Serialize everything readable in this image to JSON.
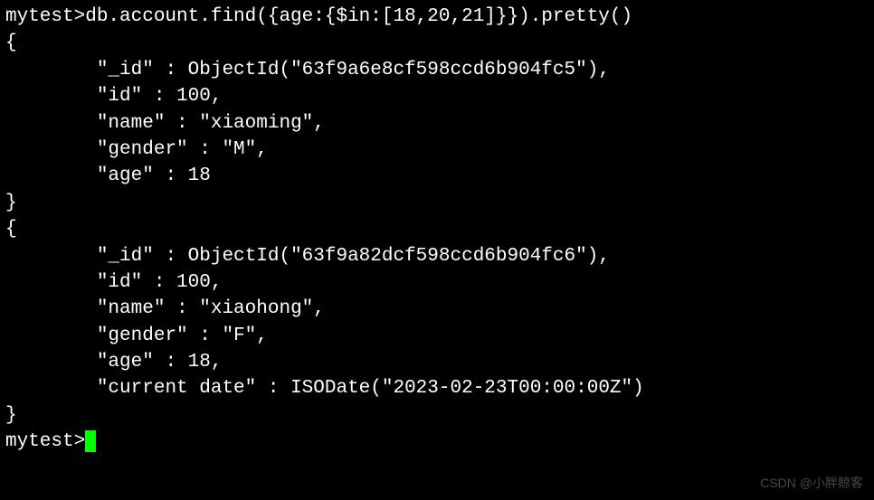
{
  "prompt": "mytest>",
  "command": "db.account.find({age:{$in:[18,20,21]}}).pretty()",
  "open_brace": "{",
  "close_brace": "}",
  "indent": "        ",
  "results": [
    {
      "_id_line": "\"_id\" : ObjectId(\"63f9a6e8cf598ccd6b904fc5\"),",
      "id_line": "\"id\" : 100,",
      "name_line": "\"name\" : \"xiaoming\",",
      "gender_line": "\"gender\" : \"M\",",
      "age_line": "\"age\" : 18"
    },
    {
      "_id_line": "\"_id\" : ObjectId(\"63f9a82dcf598ccd6b904fc6\"),",
      "id_line": "\"id\" : 100,",
      "name_line": "\"name\" : \"xiaohong\",",
      "gender_line": "\"gender\" : \"F\",",
      "age_line": "\"age\" : 18,",
      "date_line": "\"current date\" : ISODate(\"2023-02-23T00:00:00Z\")"
    }
  ],
  "watermark": "CSDN @小胖鲸客"
}
